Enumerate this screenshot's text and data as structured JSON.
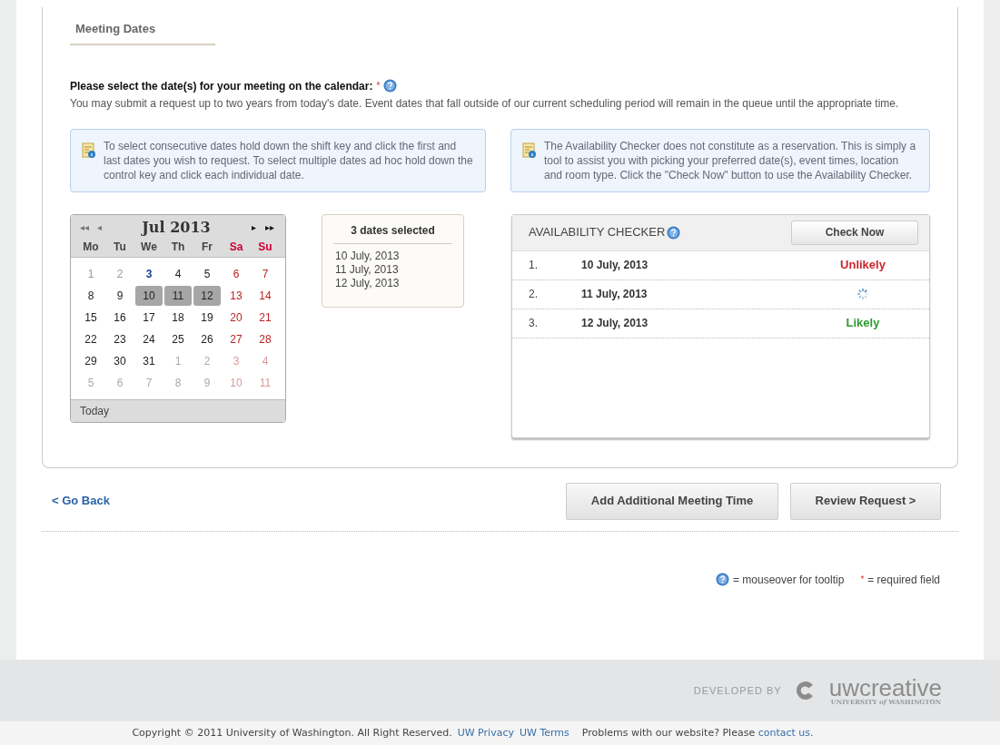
{
  "section_title": "Meeting Dates",
  "prompt": {
    "label": "Please select the date(s) for your meeting on the calendar:",
    "required_mark": "*",
    "description": "You may submit a request up to two years from today's date. Event dates that fall outside of our current scheduling period will remain in the queue until the appropriate time."
  },
  "info_boxes": [
    "To select consecutive dates hold down the shift key and click the first and last dates you wish to request. To select multiple dates ad hoc hold down the control key and click each individual date.",
    "The Availability Checker does not constitute as a reservation. This is simply a tool to assist you with picking your preferred date(s), event times, location and room type. Click the \"Check Now\" button to use the Availability Checker."
  ],
  "calendar": {
    "month": "Jul 2013",
    "nav": {
      "prev_year": "◂◂",
      "prev_month": "◂",
      "next_month": "▸",
      "next_year": "▸▸"
    },
    "weekdays": [
      "Mo",
      "Tu",
      "We",
      "Th",
      "Fr",
      "Sa",
      "Su"
    ],
    "weeks": [
      [
        {
          "label": "1",
          "kind": "past",
          "selected": false
        },
        {
          "label": "2",
          "kind": "past",
          "selected": false
        },
        {
          "label": "3",
          "kind": "today",
          "selected": false
        },
        {
          "label": "4",
          "kind": "current",
          "selected": false
        },
        {
          "label": "5",
          "kind": "current",
          "selected": false
        },
        {
          "label": "6",
          "kind": "current",
          "selected": false
        },
        {
          "label": "7",
          "kind": "current",
          "selected": false
        }
      ],
      [
        {
          "label": "8",
          "kind": "current",
          "selected": false
        },
        {
          "label": "9",
          "kind": "current",
          "selected": false
        },
        {
          "label": "10",
          "kind": "current",
          "selected": true
        },
        {
          "label": "11",
          "kind": "current",
          "selected": true
        },
        {
          "label": "12",
          "kind": "current",
          "selected": true
        },
        {
          "label": "13",
          "kind": "current",
          "selected": false
        },
        {
          "label": "14",
          "kind": "current",
          "selected": false
        }
      ],
      [
        {
          "label": "15",
          "kind": "current",
          "selected": false
        },
        {
          "label": "16",
          "kind": "current",
          "selected": false
        },
        {
          "label": "17",
          "kind": "current",
          "selected": false
        },
        {
          "label": "18",
          "kind": "current",
          "selected": false
        },
        {
          "label": "19",
          "kind": "current",
          "selected": false
        },
        {
          "label": "20",
          "kind": "current",
          "selected": false
        },
        {
          "label": "21",
          "kind": "current",
          "selected": false
        }
      ],
      [
        {
          "label": "22",
          "kind": "current",
          "selected": false
        },
        {
          "label": "23",
          "kind": "current",
          "selected": false
        },
        {
          "label": "24",
          "kind": "current",
          "selected": false
        },
        {
          "label": "25",
          "kind": "current",
          "selected": false
        },
        {
          "label": "26",
          "kind": "current",
          "selected": false
        },
        {
          "label": "27",
          "kind": "current",
          "selected": false
        },
        {
          "label": "28",
          "kind": "current",
          "selected": false
        }
      ],
      [
        {
          "label": "29",
          "kind": "current",
          "selected": false
        },
        {
          "label": "30",
          "kind": "current",
          "selected": false
        },
        {
          "label": "31",
          "kind": "current",
          "selected": false
        },
        {
          "label": "1",
          "kind": "other",
          "selected": false
        },
        {
          "label": "2",
          "kind": "other",
          "selected": false
        },
        {
          "label": "3",
          "kind": "other",
          "selected": false
        },
        {
          "label": "4",
          "kind": "other",
          "selected": false
        }
      ],
      [
        {
          "label": "5",
          "kind": "other",
          "selected": false
        },
        {
          "label": "6",
          "kind": "other",
          "selected": false
        },
        {
          "label": "7",
          "kind": "other",
          "selected": false
        },
        {
          "label": "8",
          "kind": "other",
          "selected": false
        },
        {
          "label": "9",
          "kind": "other",
          "selected": false
        },
        {
          "label": "10",
          "kind": "other",
          "selected": false
        },
        {
          "label": "11",
          "kind": "other",
          "selected": false
        }
      ]
    ],
    "today_button": "Today"
  },
  "selected_dates": {
    "title": "3 dates selected",
    "items": [
      "10 July, 2013",
      "11 July, 2013",
      "12 July, 2013"
    ]
  },
  "availability_checker": {
    "title": "AVAILABILITY CHECKER",
    "button": "Check Now",
    "rows": [
      {
        "number": "1.",
        "date": "10 July, 2013",
        "kind": "unlikely",
        "result": "Unlikely"
      },
      {
        "number": "2.",
        "date": "11 July, 2013",
        "kind": "loading"
      },
      {
        "number": "3.",
        "date": "12 July, 2013",
        "kind": "likely",
        "result": "Likely"
      }
    ]
  },
  "go_back": "< Go Back",
  "buttons": [
    "Add Additional Meeting Time",
    "Review Request >"
  ],
  "legend": {
    "tooltip": "= mouseover for tooltip",
    "required_mark": "*",
    "required": "= required field"
  },
  "footer": {
    "developed_by": "DEVELOPED BY",
    "brand": "uwcreative",
    "brand_sub": "UNIVERSITY *of* WASHINGTON",
    "copyright": "Copyright © 2011 University of Washington. All Right Reserved.",
    "links": [
      "UW Privacy",
      "UW Terms"
    ],
    "problems": "Problems with our website? Please",
    "contact": "contact us",
    "end": "."
  }
}
